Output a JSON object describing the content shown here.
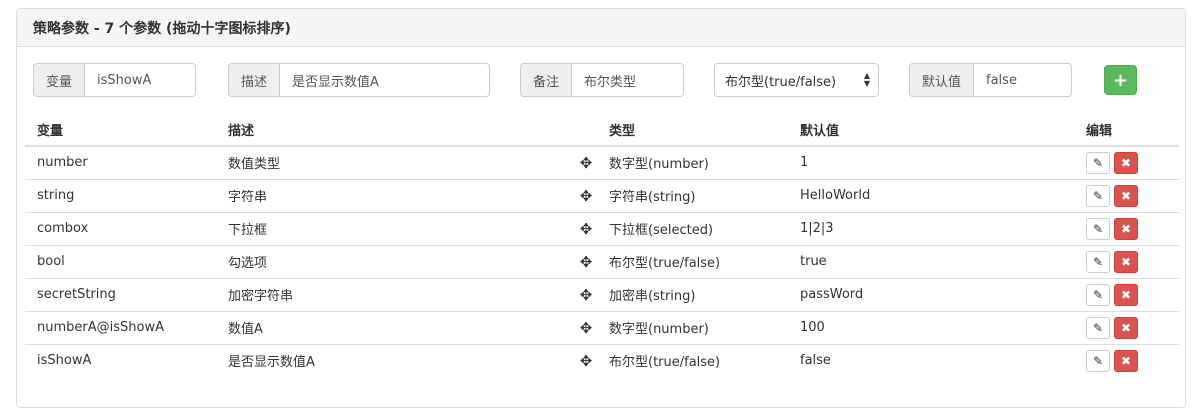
{
  "panel": {
    "title": "策略参数 - 7 个参数 (拖动十字图标排序)"
  },
  "form": {
    "variable": {
      "label": "变量",
      "value": "isShowA"
    },
    "description": {
      "label": "描述",
      "value": "是否显示数值A"
    },
    "remark": {
      "label": "备注",
      "value": "布尔类型"
    },
    "type_select": {
      "value": "布尔型(true/false)"
    },
    "default": {
      "label": "默认值",
      "value": "false"
    },
    "add_icon": "plus-icon"
  },
  "table": {
    "headers": {
      "variable": "变量",
      "description": "描述",
      "type": "类型",
      "default": "默认值",
      "edit": "编辑"
    },
    "rows": [
      {
        "variable": "number",
        "description": "数值类型",
        "type": "数字型(number)",
        "default": "1"
      },
      {
        "variable": "string",
        "description": "字符串",
        "type": "字符串(string)",
        "default": "HelloWorld"
      },
      {
        "variable": "combox",
        "description": "下拉框",
        "type": "下拉框(selected)",
        "default": "1|2|3"
      },
      {
        "variable": "bool",
        "description": "勾选项",
        "type": "布尔型(true/false)",
        "default": "true"
      },
      {
        "variable": "secretString",
        "description": "加密字符串",
        "type": "加密串(string)",
        "default": "passWord"
      },
      {
        "variable": "numberA@isShowA",
        "description": "数值A",
        "type": "数字型(number)",
        "default": "100"
      },
      {
        "variable": "isShowA",
        "description": "是否显示数值A",
        "type": "布尔型(true/false)",
        "default": "false"
      }
    ]
  },
  "colors": {
    "add_button": "#5cb85c",
    "delete_button": "#d9534f",
    "heading_bg": "#f5f5f5"
  }
}
